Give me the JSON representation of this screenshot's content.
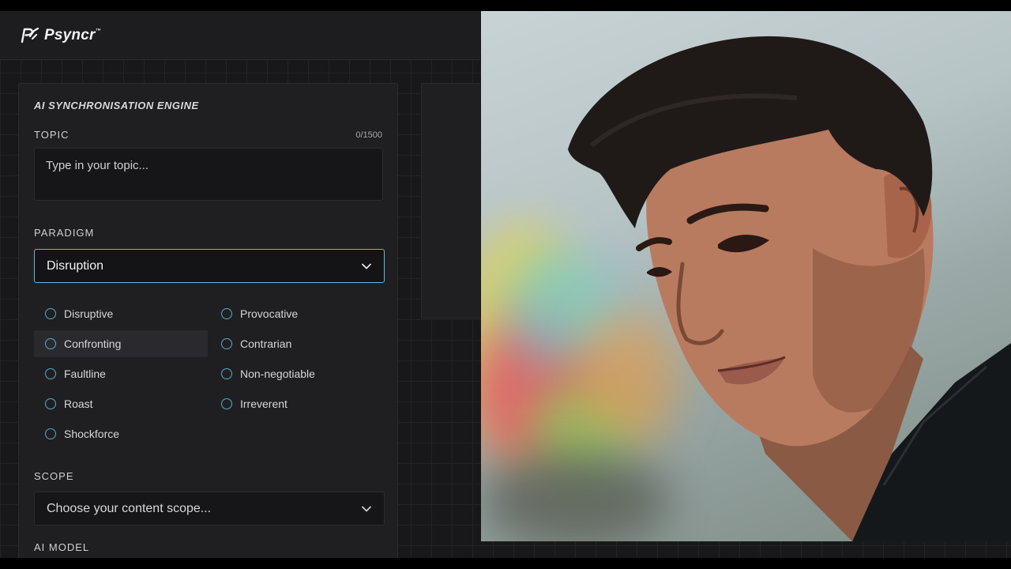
{
  "app": {
    "name": "Psyncr",
    "tm": "™"
  },
  "engine": {
    "title": "AI SYNCHRONISATION ENGINE"
  },
  "topic": {
    "label": "TOPIC",
    "counter": "0/1500",
    "placeholder": "Type in your topic..."
  },
  "paradigm": {
    "label": "PARADIGM",
    "selected": "Disruption",
    "options": [
      {
        "label": "Disruptive"
      },
      {
        "label": "Provocative"
      },
      {
        "label": "Confronting",
        "hovered": true
      },
      {
        "label": "Contrarian"
      },
      {
        "label": "Faultline"
      },
      {
        "label": "Non-negotiable"
      },
      {
        "label": "Roast"
      },
      {
        "label": "Irreverent"
      },
      {
        "label": "Shockforce"
      }
    ]
  },
  "scope": {
    "label": "SCOPE",
    "placeholder": "Choose your content scope..."
  },
  "ai_model": {
    "label": "AI MODEL"
  },
  "colors": {
    "accent": "#5fb8d6",
    "panel": "#1f1f22",
    "background": "#18181a"
  },
  "icons": {
    "logo": "psyncr-logo-icon",
    "chevron": "chevron-down-icon",
    "radio": "radio-icon"
  }
}
